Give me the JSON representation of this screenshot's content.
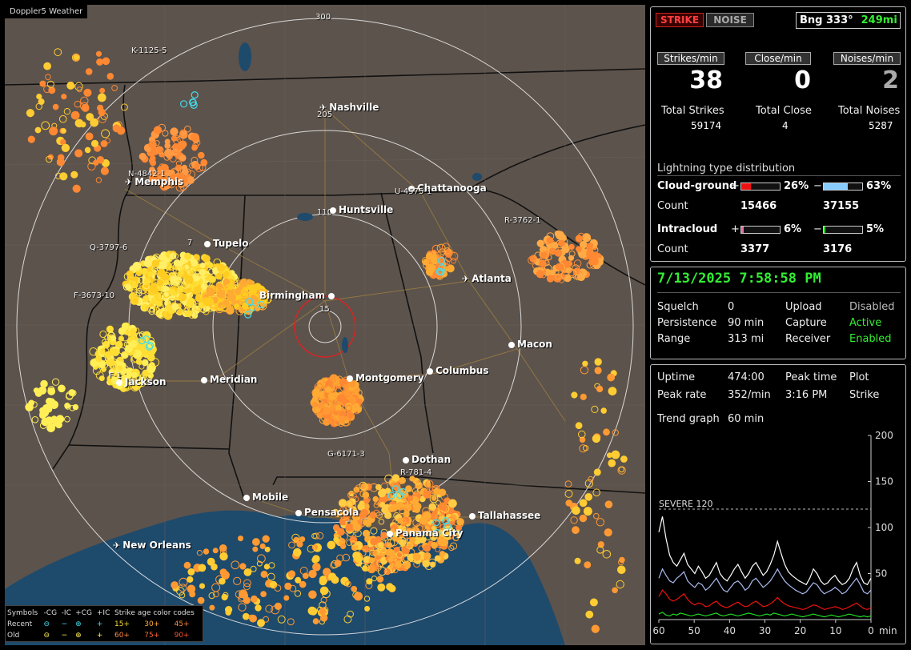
{
  "map": {
    "title": "Doppler5 Weather",
    "range_labels": [
      "300",
      "205",
      "110",
      "15"
    ],
    "cities": [
      {
        "name": "Nashville",
        "type": "airport"
      },
      {
        "name": "Memphis",
        "type": "airport"
      },
      {
        "name": "Chattanooga",
        "type": "city"
      },
      {
        "name": "Huntsville",
        "type": "city"
      },
      {
        "name": "Tupelo",
        "type": "city"
      },
      {
        "name": "Atlanta",
        "type": "airport"
      },
      {
        "name": "Birmingham",
        "type": "city"
      },
      {
        "name": "Macon",
        "type": "city"
      },
      {
        "name": "Jackson",
        "type": "city"
      },
      {
        "name": "Meridian",
        "type": "city"
      },
      {
        "name": "Montgomery",
        "type": "city"
      },
      {
        "name": "Columbus",
        "type": "city"
      },
      {
        "name": "Dothan",
        "type": "city"
      },
      {
        "name": "Mobile",
        "type": "city"
      },
      {
        "name": "Pensacola",
        "type": "city"
      },
      {
        "name": "Tallahassee",
        "type": "city"
      },
      {
        "name": "Panama City",
        "type": "city"
      },
      {
        "name": "New Orleans",
        "type": "airport"
      }
    ],
    "storms": [
      "K-1125-5",
      "N-4842-1",
      "U-4575-1",
      "Q-3797-6",
      "R-3762-1",
      "F-3673-10",
      "G-6171-3",
      "R-781-4"
    ],
    "storm_partial": [
      "F-1",
      "S-4",
      "7"
    ]
  },
  "legend": {
    "symbols": "Symbols",
    "cols": [
      "-CG",
      "-IC",
      "+CG",
      "+IC"
    ],
    "age_title": "Strike age color codes",
    "recent": "Recent",
    "old": "Old",
    "recent_ages": [
      "15+",
      "30+",
      "45+"
    ],
    "old_ages": [
      "60+",
      "75+",
      "90+"
    ]
  },
  "status": {
    "strike_btn": "STRIKE",
    "noise_btn": "NOISE",
    "bearing": "Bng 333°",
    "distance": "249mi",
    "strikes_min_label": "Strikes/min",
    "close_min_label": "Close/min",
    "noises_min_label": "Noises/min",
    "strikes_min": "38",
    "close_min": "0",
    "noises_min": "2",
    "total_strikes_label": "Total Strikes",
    "total_close_label": "Total Close",
    "total_noises_label": "Total Noises",
    "total_strikes": "59174",
    "total_close": "4",
    "total_noises": "5287",
    "dist_title": "Lightning type distribution",
    "cg_label": "Cloud-ground",
    "ic_label": "Intracloud",
    "count_label": "Count",
    "plus": "+",
    "minus": "−",
    "cg_plus_pct": "26%",
    "cg_minus_pct": "63%",
    "cg_plus_count": "15466",
    "cg_minus_count": "37155",
    "ic_plus_pct": "6%",
    "ic_minus_pct": "5%",
    "ic_plus_count": "3377",
    "ic_minus_count": "3176",
    "cg_plus_frac": 0.26,
    "cg_minus_frac": 0.63,
    "ic_plus_frac": 0.06,
    "ic_minus_frac": 0.05,
    "cg_plus_color": "#ee1111",
    "cg_minus_color": "#88ccff",
    "ic_plus_color": "#ee66aa",
    "ic_minus_color": "#22dd22"
  },
  "settings": {
    "datetime": "7/13/2025 7:58:58 PM",
    "squelch_label": "Squelch",
    "squelch": "0",
    "persistence_label": "Persistence",
    "persistence": "90 min",
    "range_label": "Range",
    "range": "313 mi",
    "upload_label": "Upload",
    "upload": "Disabled",
    "capture_label": "Capture",
    "capture": "Active",
    "receiver_label": "Receiver",
    "receiver": "Enabled"
  },
  "trend": {
    "uptime_label": "Uptime",
    "uptime": "474:00",
    "peak_time_label": "Peak time",
    "peak_time": "3:16 PM",
    "plot_label": "Plot",
    "plot": "Strike",
    "peak_rate_label": "Peak rate",
    "peak_rate": "352/min",
    "trend_label": "Trend graph",
    "trend": "60 min"
  },
  "chart_data": {
    "type": "line",
    "xlabel": "min",
    "ylim": [
      0,
      200
    ],
    "xlim": [
      60,
      0
    ],
    "y_ticks": [
      "200",
      "150",
      "100",
      "50"
    ],
    "x_ticks": [
      "60",
      "50",
      "40",
      "30",
      "20",
      "10",
      "0"
    ],
    "threshold": {
      "label": "SEVERE 120",
      "value": 120
    },
    "series": [
      {
        "color": "#ffffff",
        "values": [
          95,
          112,
          88,
          70,
          62,
          58,
          65,
          72,
          60,
          55,
          50,
          58,
          52,
          45,
          48,
          55,
          62,
          50,
          45,
          42,
          48,
          55,
          60,
          52,
          45,
          50,
          58,
          62,
          55,
          48,
          52,
          60,
          70,
          85,
          72,
          60,
          52,
          48,
          45,
          42,
          40,
          38,
          45,
          55,
          50,
          42,
          38,
          40,
          45,
          48,
          42,
          38,
          40,
          45,
          55,
          62,
          48,
          40,
          38,
          45
        ]
      },
      {
        "color": "#aabbee",
        "values": [
          45,
          55,
          48,
          42,
          40,
          45,
          48,
          52,
          42,
          38,
          35,
          40,
          38,
          32,
          35,
          40,
          45,
          38,
          32,
          30,
          35,
          40,
          42,
          38,
          32,
          35,
          42,
          45,
          40,
          35,
          38,
          42,
          48,
          55,
          48,
          42,
          38,
          35,
          32,
          30,
          28,
          30,
          35,
          40,
          38,
          32,
          28,
          30,
          32,
          35,
          32,
          28,
          30,
          35,
          40,
          45,
          38,
          30,
          28,
          32
        ]
      },
      {
        "color": "#ee1111",
        "values": [
          25,
          32,
          28,
          22,
          20,
          22,
          25,
          28,
          22,
          18,
          16,
          18,
          17,
          14,
          15,
          18,
          20,
          16,
          14,
          13,
          15,
          17,
          19,
          16,
          14,
          15,
          18,
          20,
          17,
          14,
          15,
          17,
          20,
          24,
          20,
          17,
          15,
          14,
          13,
          12,
          11,
          12,
          14,
          16,
          15,
          13,
          11,
          12,
          13,
          14,
          13,
          11,
          12,
          14,
          16,
          18,
          15,
          12,
          11,
          13
        ]
      },
      {
        "color": "#22dd22",
        "values": [
          6,
          8,
          5,
          4,
          6,
          5,
          7,
          6,
          5,
          4,
          5,
          6,
          5,
          4,
          5,
          6,
          7,
          5,
          4,
          5,
          6,
          5,
          4,
          5,
          6,
          7,
          6,
          5,
          4,
          5,
          6,
          5,
          7,
          6,
          5,
          4,
          5,
          6,
          5,
          4,
          3,
          4,
          5,
          6,
          5,
          4,
          3,
          4,
          5,
          4,
          3,
          4,
          5,
          6,
          5,
          4,
          3,
          4,
          3,
          4
        ]
      }
    ]
  }
}
